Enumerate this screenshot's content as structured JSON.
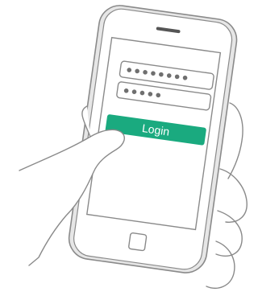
{
  "login_button": {
    "label": "Login",
    "color": "#1aaa7f"
  },
  "username_field": {
    "masked_length": 8
  },
  "password_field": {
    "masked_length": 5
  },
  "phone": {
    "outline_color": "#8a8a8a",
    "screen_color": "#ffffff"
  },
  "icons": {
    "speaker": "speaker-slot-icon",
    "home": "home-button-icon"
  }
}
